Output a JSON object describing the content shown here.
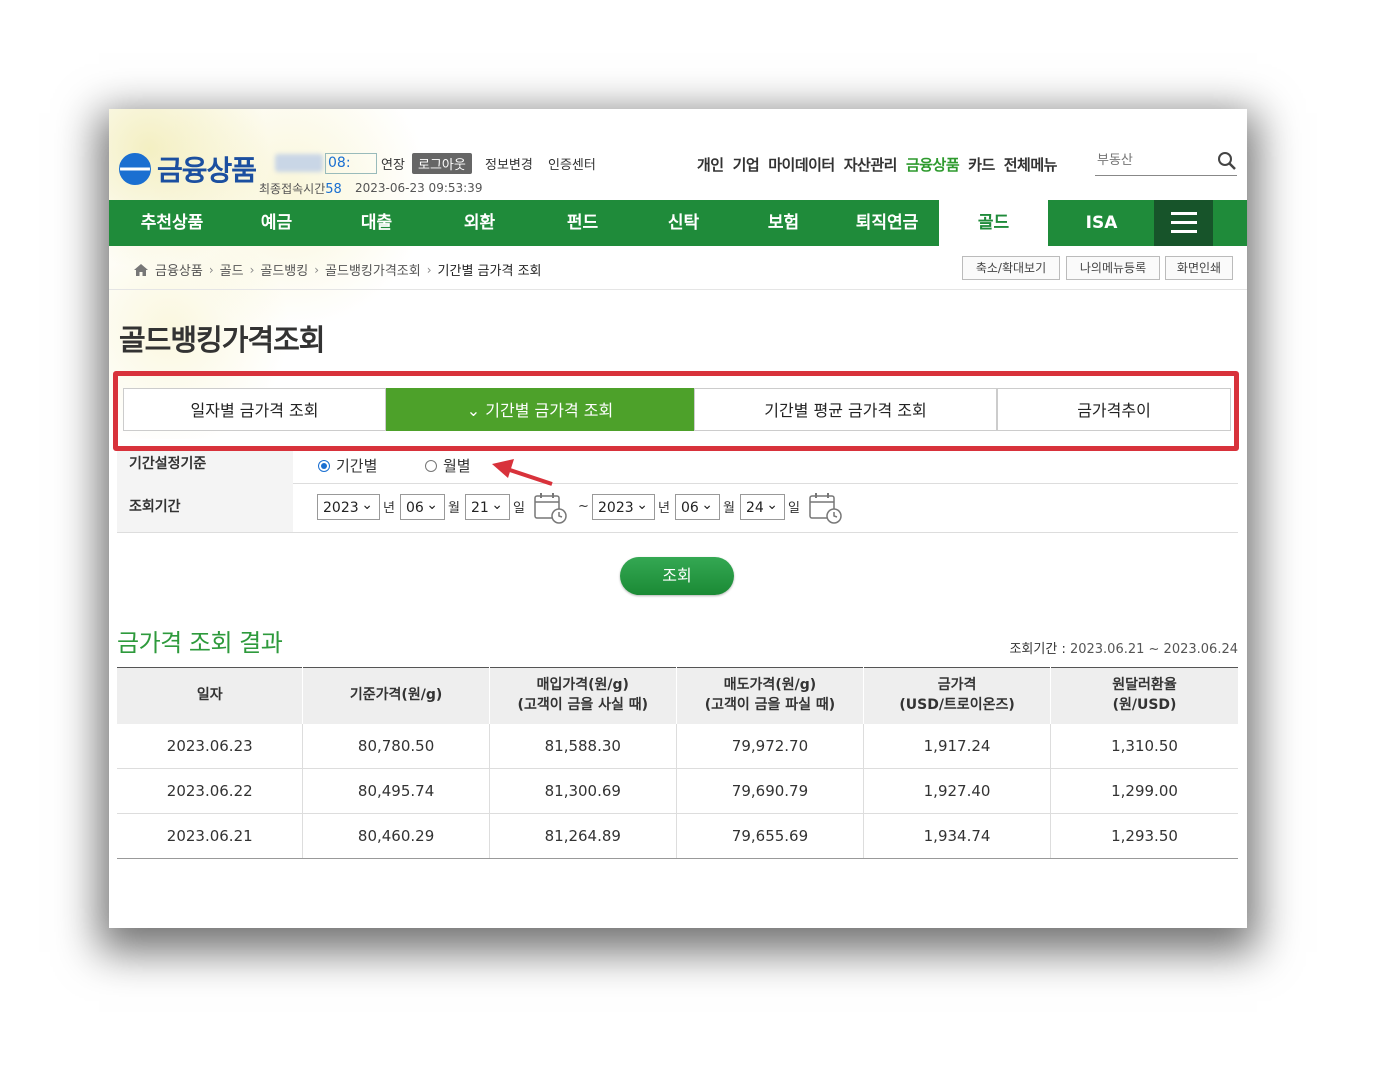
{
  "header": {
    "logo_text": "금융상품",
    "timer": "08:",
    "extend_label": "연장",
    "logout_label": "로그아웃",
    "profile_label": "정보변경",
    "cert_label": "인증센터",
    "last_login_label": "최종접속시간",
    "timer_seconds": "58",
    "last_login_time": "2023-06-23 09:53:39",
    "top_menu": [
      "개인",
      "기업",
      "마이데이터",
      "자산관리",
      "금융상품",
      "카드",
      "전체메뉴"
    ],
    "top_menu_active": "금융상품",
    "search_placeholder": "부동산"
  },
  "nav": {
    "items": [
      "추천상품",
      "예금",
      "대출",
      "외환",
      "펀드",
      "신탁",
      "보험",
      "퇴직연금",
      "골드",
      "ISA"
    ],
    "active": "골드"
  },
  "breadcrumb": {
    "items": [
      "금융상품",
      "골드",
      "골드뱅킹",
      "골드뱅킹가격조회",
      "기간별 금가격 조회"
    ],
    "utils": [
      "축소/확대보기",
      "나의메뉴등록",
      "화면인쇄"
    ]
  },
  "page_title": "골드뱅킹가격조회",
  "tabs": {
    "items": [
      "일자별 금가격 조회",
      "기간별 금가격 조회",
      "기간별 평균 금가격 조회",
      "금가격추이"
    ],
    "active_index": 1
  },
  "form": {
    "basis_label": "기간설정기준",
    "basis_options": [
      "기간별",
      "월별"
    ],
    "basis_selected": "기간별",
    "period_label": "조회기간",
    "from": {
      "year": "2023",
      "month": "06",
      "day": "21"
    },
    "to": {
      "year": "2023",
      "month": "06",
      "day": "24"
    },
    "unit_year": "년",
    "unit_month": "월",
    "unit_day": "일",
    "tilde": "~",
    "search_button": "조회"
  },
  "result": {
    "title": "금가격 조회 결과",
    "period_label": "조회기간 :",
    "period_value": "2023.06.21 ~ 2023.06.24",
    "columns": [
      [
        "일자"
      ],
      [
        "기준가격(원/g)"
      ],
      [
        "매입가격(원/g)",
        "(고객이 금을 사실 때)"
      ],
      [
        "매도가격(원/g)",
        "(고객이 금을 파실 때)"
      ],
      [
        "금가격",
        "(USD/트로이온즈)"
      ],
      [
        "원달러환율",
        "(원/USD)"
      ]
    ],
    "rows": [
      [
        "2023.06.23",
        "80,780.50",
        "81,588.30",
        "79,972.70",
        "1,917.24",
        "1,310.50"
      ],
      [
        "2023.06.22",
        "80,495.74",
        "81,300.69",
        "79,690.79",
        "1,927.40",
        "1,299.00"
      ],
      [
        "2023.06.21",
        "80,460.29",
        "81,264.89",
        "79,655.69",
        "1,934.74",
        "1,293.50"
      ]
    ]
  },
  "colors": {
    "nav_green": "#1f8b3a",
    "tab_active": "#4da12a",
    "highlight_red": "#d8323b",
    "result_title": "#2e9a3c"
  }
}
